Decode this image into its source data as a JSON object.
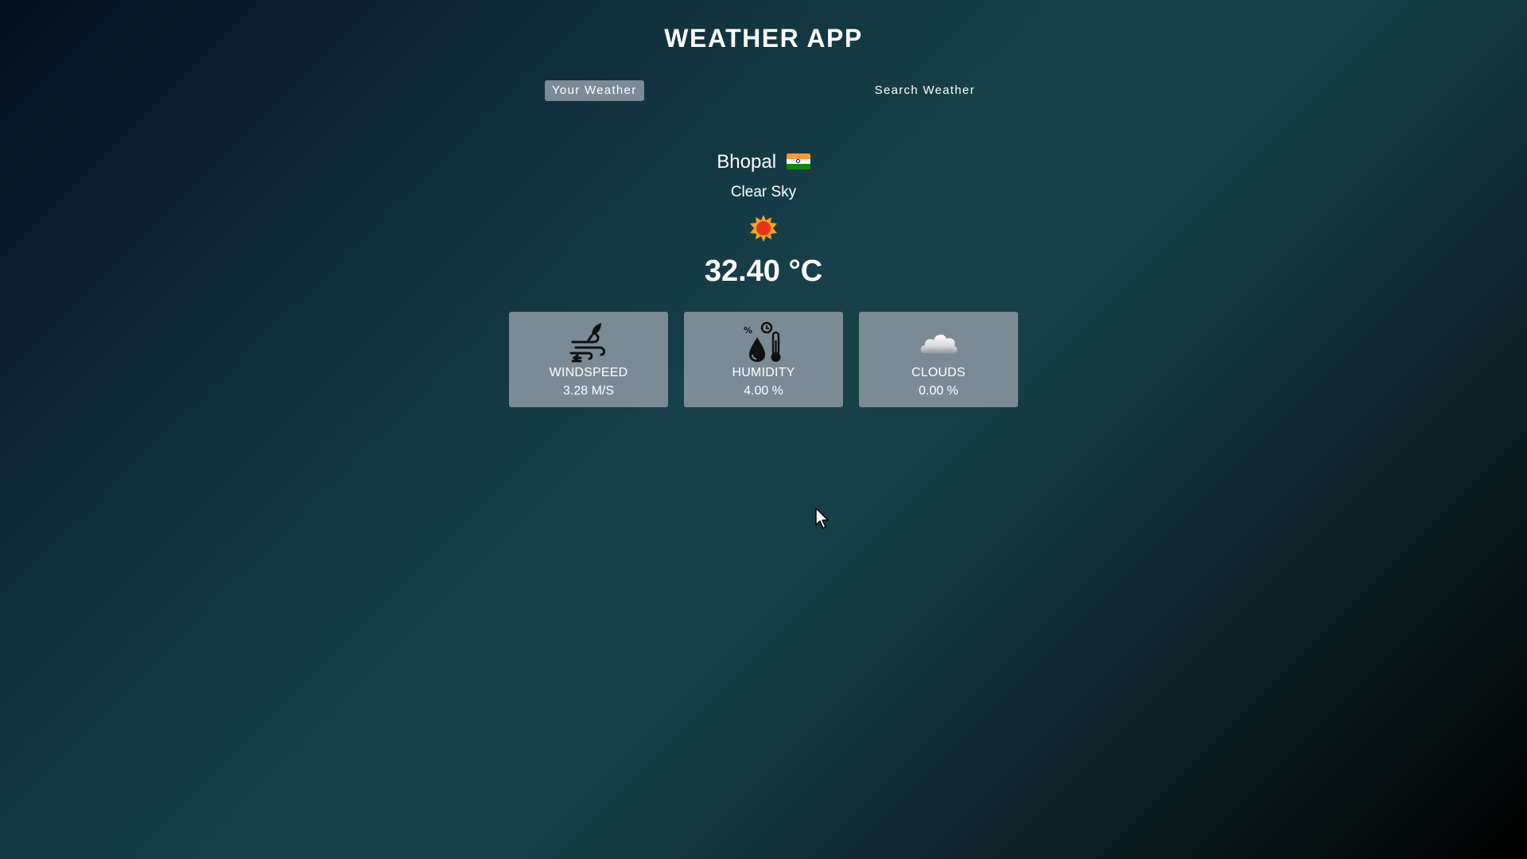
{
  "header": {
    "title": "WEATHER APP"
  },
  "tabs": [
    {
      "label": "Your Weather",
      "active": true
    },
    {
      "label": "Search Weather",
      "active": false
    }
  ],
  "location": {
    "city": "Bhopal",
    "flag_icon": "india-flag-icon"
  },
  "weather": {
    "condition": "Clear Sky",
    "icon": "sun-icon",
    "temperature": "32.40 °C"
  },
  "stats": [
    {
      "label": "WINDSPEED",
      "value": "3.28 M/S",
      "icon": "wind-icon"
    },
    {
      "label": "HUMIDITY",
      "value": "4.00 %",
      "icon": "humidity-icon"
    },
    {
      "label": "CLOUDS",
      "value": "0.00 %",
      "icon": "cloud-icon"
    }
  ],
  "colors": {
    "card_background": "#7a8b96",
    "active_tab_background": "#7a8b96",
    "text": "#ffffff",
    "sun": "#e8331b"
  }
}
